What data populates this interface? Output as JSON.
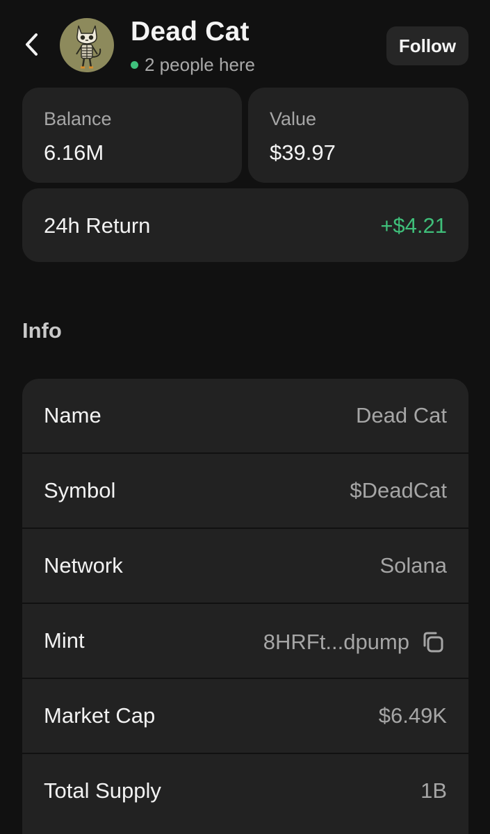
{
  "header": {
    "title": "Dead Cat",
    "presence_text": "2 people here",
    "follow_label": "Follow",
    "avatar_icon": "skeleton-cat-avatar"
  },
  "stats": {
    "balance": {
      "label": "Balance",
      "value": "6.16M"
    },
    "value": {
      "label": "Value",
      "value": "$39.97"
    },
    "return_24h": {
      "label": "24h Return",
      "value": "+$4.21"
    }
  },
  "info": {
    "title": "Info",
    "rows": [
      {
        "key": "Name",
        "value": "Dead Cat"
      },
      {
        "key": "Symbol",
        "value": "$DeadCat"
      },
      {
        "key": "Network",
        "value": "Solana"
      },
      {
        "key": "Mint",
        "value": "8HRFt...dpump",
        "icon": "copy-icon"
      },
      {
        "key": "Market Cap",
        "value": "$6.49K"
      },
      {
        "key": "Total Supply",
        "value": "1B"
      }
    ]
  },
  "colors": {
    "background": "#111111",
    "card": "#222222",
    "positive": "#3fbf7a",
    "muted_text": "#a6a6a6"
  }
}
